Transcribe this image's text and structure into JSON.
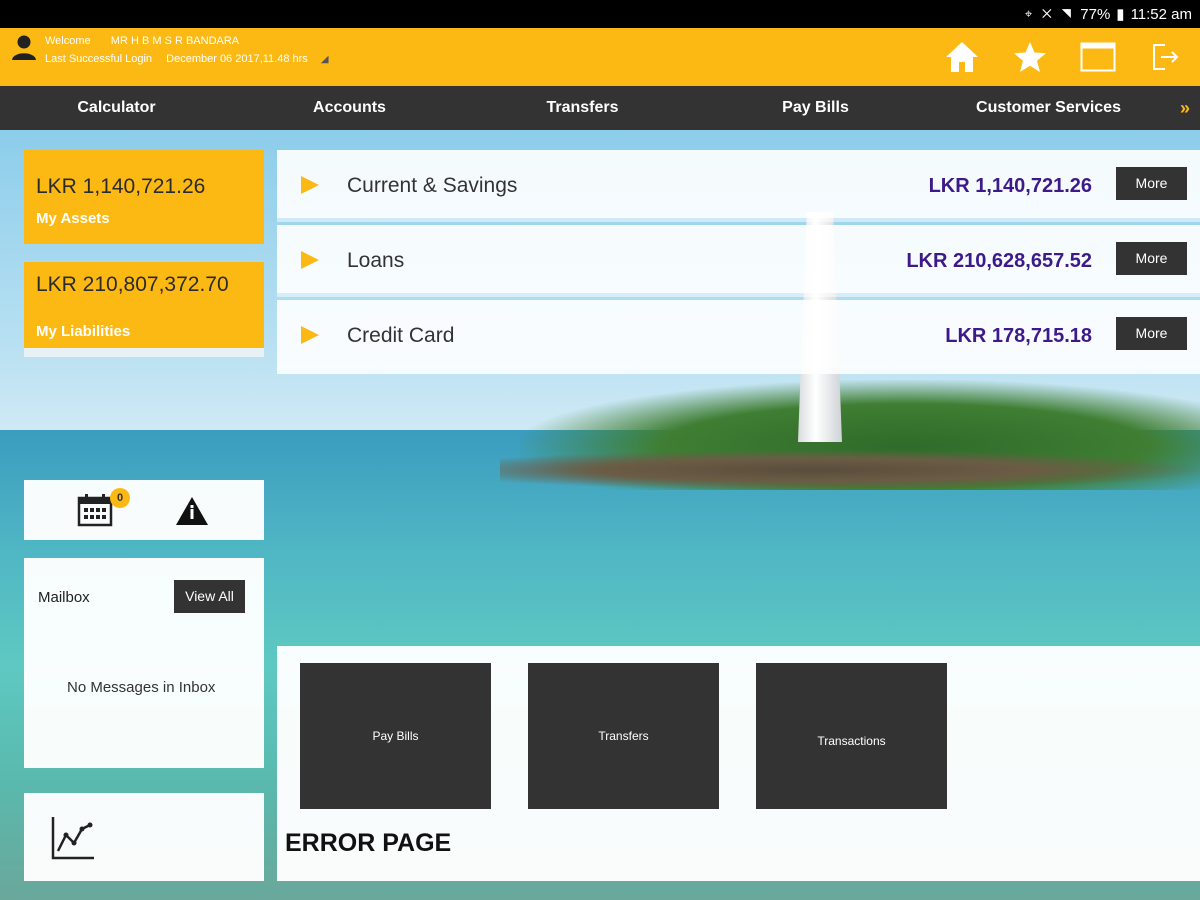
{
  "status_bar": {
    "battery": "77%",
    "time": "11:52 am"
  },
  "header": {
    "welcome_label": "Welcome",
    "user_name": "MR H B M S R BANDARA",
    "last_login_label": "Last Successful Login",
    "last_login_value": "December 06 2017,11.48 hrs",
    "icons": [
      "home-icon",
      "favorites-star-icon",
      "window-icon",
      "logout-icon"
    ]
  },
  "nav": {
    "items": [
      "Calculator",
      "Accounts",
      "Transfers",
      "Pay Bills",
      "Customer Services"
    ],
    "more_glyph": "»"
  },
  "summary": {
    "assets_amount": "LKR 1,140,721.26",
    "assets_label": "My Assets",
    "liabilities_amount": "LKR 210,807,372.70",
    "liabilities_label": "My Liabilities"
  },
  "accounts": [
    {
      "name": "Current & Savings",
      "value": "LKR 1,140,721.26",
      "more": "More"
    },
    {
      "name": "Loans",
      "value": "LKR 210,628,657.52",
      "more": "More"
    },
    {
      "name": "Credit Card",
      "value": "LKR 178,715.18",
      "more": "More"
    }
  ],
  "alerts": {
    "calendar_count": "0"
  },
  "mailbox": {
    "title": "Mailbox",
    "view_all": "View All",
    "empty_message": "No Messages in Inbox"
  },
  "quick_actions": [
    "Pay Bills",
    "Transfers",
    "Transactions"
  ],
  "error_title": "ERROR PAGE",
  "colors": {
    "brand_yellow": "#fdb913",
    "nav_dark": "#333333",
    "amount_purple": "#3d1a8a"
  }
}
